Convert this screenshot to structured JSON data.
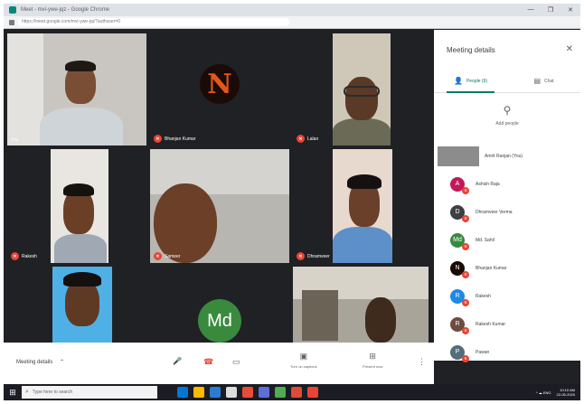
{
  "browser": {
    "title": "Meet - mvi-ywe-jqz - Google Chrome",
    "url": "https://meet.google.com/mvi-ywe-jqz?authuser=0",
    "window_controls": [
      "—",
      "❐",
      "✕"
    ]
  },
  "tiles": [
    {
      "name": "You",
      "muted": false
    },
    {
      "name": "Bhanjan Kumar",
      "muted": true
    },
    {
      "name": "Lalan",
      "muted": true
    },
    {
      "name": "Rakesh",
      "muted": true
    },
    {
      "name": "Sameer",
      "muted": true
    },
    {
      "name": "Dhramveer",
      "muted": true
    },
    {
      "name": "",
      "muted": false
    },
    {
      "name": "",
      "muted": false
    },
    {
      "name": "",
      "muted": false
    }
  ],
  "avatars": {
    "bhanjan_letter": "N",
    "md_initials": "Md"
  },
  "panel": {
    "title": "Meeting details",
    "close": "✕",
    "tabs": [
      {
        "label": "People (9)",
        "icon": "👤",
        "active": true
      },
      {
        "label": "Chat",
        "icon": "▤",
        "active": false
      }
    ],
    "add_people": "Add people",
    "participants": [
      {
        "name": "Amrit Ranjan (You)",
        "initial": "",
        "color": "#8c8c8c"
      },
      {
        "name": "Ashish Raja",
        "initial": "A",
        "color": "#c2185b"
      },
      {
        "name": "Dhramveer Verma",
        "initial": "D",
        "color": "#3c4043"
      },
      {
        "name": "Md. Sahil",
        "initial": "Md",
        "color": "#3a8a3e"
      },
      {
        "name": "Bhanjan Kumar",
        "initial": "N",
        "color": "#1b0b07"
      },
      {
        "name": "Rakesh",
        "initial": "R",
        "color": "#1e88e5"
      },
      {
        "name": "Rakesh Kumar",
        "initial": "R",
        "color": "#6d4c41"
      },
      {
        "name": "Pawan",
        "initial": "P",
        "color": "#546e7a"
      }
    ]
  },
  "controls": {
    "meeting_details": "Meeting details",
    "chevron": "⌃",
    "mic": "🎤",
    "hangup": "☎",
    "camera": "▭",
    "captions_icon": "▣",
    "captions_label": "Turn on captions",
    "present_icon": "⊞",
    "present_label": "Present now",
    "more": "⋮"
  },
  "taskbar": {
    "start": "⊞",
    "search_icon": "⌕",
    "search_placeholder": "Type here to search",
    "tray": "^ ☁ ENG",
    "time": "10:10 AM",
    "date": "22-05-2020",
    "icon_colors": [
      "#0078d4",
      "#ffb900",
      "#2b7cd3",
      "#dddddd",
      "#e74c3c",
      "#5b6fd6",
      "#4caf50",
      "#dd4b39",
      "#ea4335"
    ]
  },
  "colors": {
    "accent": "#00796b",
    "muted_badge": "#ea4335",
    "meet_bg": "#202124"
  }
}
